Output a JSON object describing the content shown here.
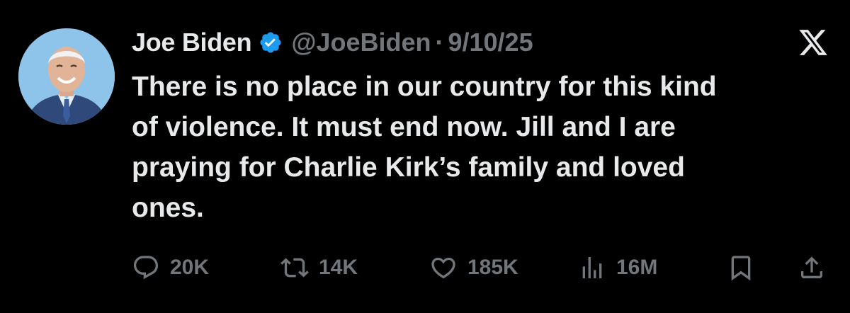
{
  "author": {
    "display_name": "Joe Biden",
    "handle": "@JoeBiden",
    "separator": "·",
    "date": "9/10/25",
    "verified": true,
    "verified_color": "#1d9bf0"
  },
  "tweet": {
    "text": "There is no place in our country for this kind\nof violence. It must end now. Jill and I are\npraying for Charlie Kirk’s family and loved\nones."
  },
  "actions": {
    "replies": "20K",
    "reposts": "14K",
    "likes": "185K",
    "views": "16M"
  },
  "icons": {
    "platform": "x-logo-icon",
    "reply": "reply-icon",
    "repost": "repost-icon",
    "like": "heart-icon",
    "views": "views-icon",
    "bookmark": "bookmark-icon",
    "share": "share-icon"
  },
  "colors": {
    "background": "#000000",
    "primary_text": "#e7e9ea",
    "secondary_text": "#71767b"
  }
}
